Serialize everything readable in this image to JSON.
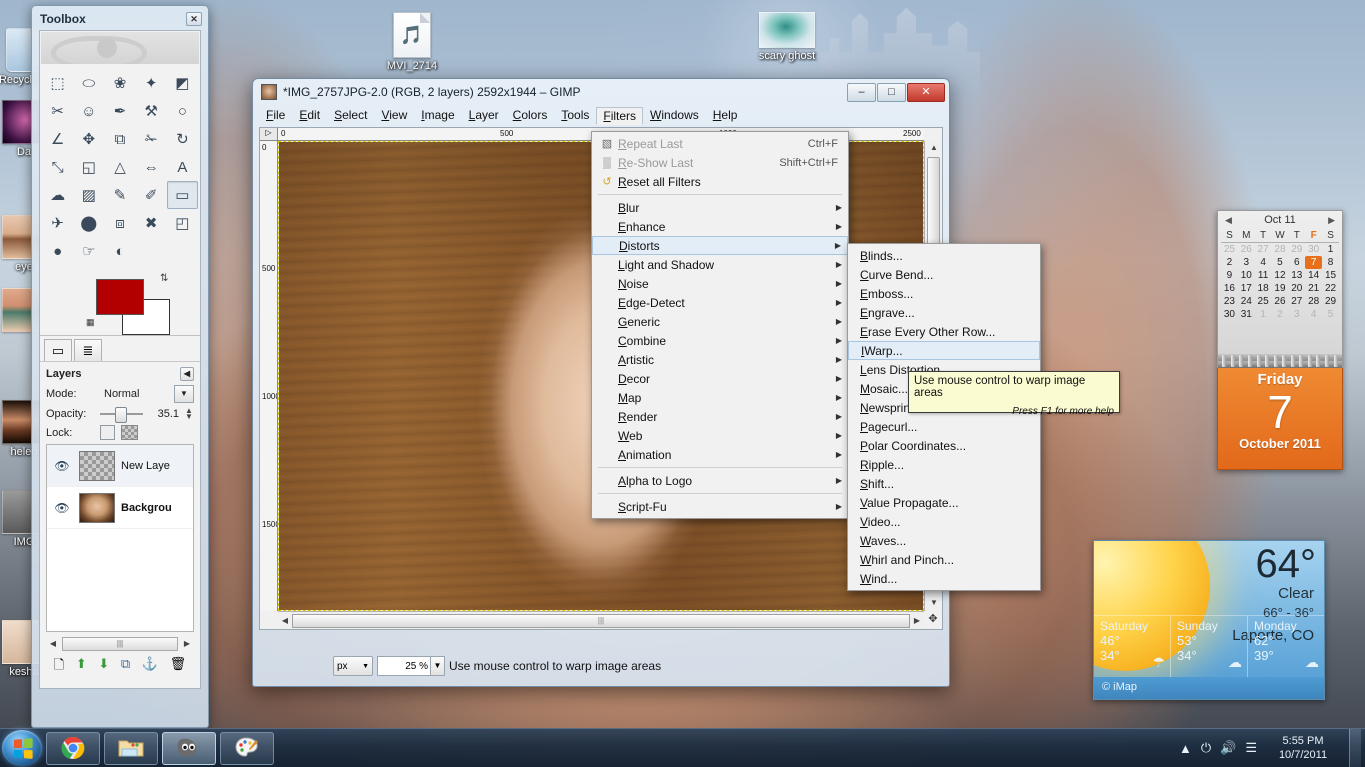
{
  "desktop": {
    "icons": [
      {
        "name": "Recycle Bin",
        "label": "Recycle Bin",
        "type": "recycle-bin"
      },
      {
        "name": "Dark",
        "label": "Da",
        "type": "image"
      },
      {
        "name": "eye",
        "label": "eye",
        "type": "image"
      },
      {
        "name": "eye2",
        "label": "",
        "type": "image"
      },
      {
        "name": "helen",
        "label": "helen",
        "type": "image"
      },
      {
        "name": "IMG",
        "label": "IMG",
        "type": "image"
      },
      {
        "name": "kesha",
        "label": "kesha",
        "type": "image"
      },
      {
        "name": "MVI_2714",
        "label": "MVI_2714",
        "type": "video-file"
      },
      {
        "name": "scary ghost",
        "label": "scary ghost",
        "type": "image"
      }
    ]
  },
  "calendar": {
    "header": "Oct 11",
    "prev_arrow": "◀",
    "next_arrow": "▶",
    "weekday_headers": [
      "S",
      "M",
      "T",
      "W",
      "T",
      "F",
      "S"
    ],
    "weeks": [
      [
        {
          "d": "25",
          "s": "dim"
        },
        {
          "d": "26",
          "s": "dim"
        },
        {
          "d": "27",
          "s": "dim"
        },
        {
          "d": "28",
          "s": "dim"
        },
        {
          "d": "29",
          "s": "dim"
        },
        {
          "d": "30",
          "s": "dim"
        },
        {
          "d": "1",
          "s": ""
        }
      ],
      [
        {
          "d": "2",
          "s": ""
        },
        {
          "d": "3",
          "s": ""
        },
        {
          "d": "4",
          "s": ""
        },
        {
          "d": "5",
          "s": ""
        },
        {
          "d": "6",
          "s": ""
        },
        {
          "d": "7",
          "s": "today"
        },
        {
          "d": "8",
          "s": ""
        }
      ],
      [
        {
          "d": "9",
          "s": ""
        },
        {
          "d": "10",
          "s": ""
        },
        {
          "d": "11",
          "s": ""
        },
        {
          "d": "12",
          "s": ""
        },
        {
          "d": "13",
          "s": ""
        },
        {
          "d": "14",
          "s": ""
        },
        {
          "d": "15",
          "s": ""
        }
      ],
      [
        {
          "d": "16",
          "s": ""
        },
        {
          "d": "17",
          "s": ""
        },
        {
          "d": "18",
          "s": ""
        },
        {
          "d": "19",
          "s": ""
        },
        {
          "d": "20",
          "s": ""
        },
        {
          "d": "21",
          "s": ""
        },
        {
          "d": "22",
          "s": ""
        }
      ],
      [
        {
          "d": "23",
          "s": ""
        },
        {
          "d": "24",
          "s": ""
        },
        {
          "d": "25",
          "s": ""
        },
        {
          "d": "26",
          "s": ""
        },
        {
          "d": "27",
          "s": ""
        },
        {
          "d": "28",
          "s": ""
        },
        {
          "d": "29",
          "s": ""
        }
      ],
      [
        {
          "d": "30",
          "s": ""
        },
        {
          "d": "31",
          "s": ""
        },
        {
          "d": "1",
          "s": "dim"
        },
        {
          "d": "2",
          "s": "dim"
        },
        {
          "d": "3",
          "s": "dim"
        },
        {
          "d": "4",
          "s": "dim"
        },
        {
          "d": "5",
          "s": "dim"
        }
      ]
    ],
    "day_name": "Friday",
    "day_number": "7",
    "month_year": "October 2011"
  },
  "weather": {
    "temperature": "64°",
    "condition": "Clear",
    "high_low": "66° - 36°",
    "location": "Laporte, CO",
    "forecast": [
      {
        "day": "Saturday",
        "high": "46°",
        "low": "34°",
        "icon": "rain"
      },
      {
        "day": "Sunday",
        "high": "53°",
        "low": "34°",
        "icon": "cloudy"
      },
      {
        "day": "Monday",
        "high": "62°",
        "low": "39°",
        "icon": "cloudy"
      }
    ],
    "attribution": "© iMap"
  },
  "toolbox": {
    "title": "Toolbox",
    "close_label": "✕",
    "tools": [
      {
        "n": "rect-select-tool",
        "g": "⬚"
      },
      {
        "n": "ellipse-select-tool",
        "g": "⬭"
      },
      {
        "n": "free-select-tool",
        "g": "❀"
      },
      {
        "n": "fuzzy-select-tool",
        "g": "✦"
      },
      {
        "n": "select-by-color-tool",
        "g": "◩"
      },
      {
        "n": "scissors-select-tool",
        "g": "✂"
      },
      {
        "n": "foreground-select-tool",
        "g": "☺"
      },
      {
        "n": "paths-tool",
        "g": "✒"
      },
      {
        "n": "color-picker-tool",
        "g": "⚒"
      },
      {
        "n": "zoom-tool",
        "g": "○"
      },
      {
        "n": "measure-tool",
        "g": "∠"
      },
      {
        "n": "move-tool",
        "g": "✥"
      },
      {
        "n": "alignment-tool",
        "g": "⧉"
      },
      {
        "n": "crop-tool",
        "g": "✁"
      },
      {
        "n": "rotate-tool",
        "g": "↻"
      },
      {
        "n": "scale-tool",
        "g": "⤡"
      },
      {
        "n": "shear-tool",
        "g": "◱"
      },
      {
        "n": "perspective-tool",
        "g": "△"
      },
      {
        "n": "flip-tool",
        "g": "⇔"
      },
      {
        "n": "text-tool",
        "g": "A"
      },
      {
        "n": "bucket-fill-tool",
        "g": "☁"
      },
      {
        "n": "gradient-tool",
        "g": "▨"
      },
      {
        "n": "pencil-tool",
        "g": "✎"
      },
      {
        "n": "paintbrush-tool",
        "g": "✐"
      },
      {
        "n": "eraser-tool",
        "g": "▭",
        "sel": true
      },
      {
        "n": "airbrush-tool",
        "g": "✈"
      },
      {
        "n": "ink-tool",
        "g": "⬤"
      },
      {
        "n": "clone-tool",
        "g": "⧈"
      },
      {
        "n": "heal-tool",
        "g": "✖"
      },
      {
        "n": "perspective-clone-tool",
        "g": "◰"
      },
      {
        "n": "blur-sharpen-tool",
        "g": "●"
      },
      {
        "n": "smudge-tool",
        "g": "☞"
      },
      {
        "n": "dodge-burn-tool",
        "g": "◐"
      }
    ],
    "foreground_color": "#b20000",
    "background_color": "#ffffff",
    "tabs": [
      {
        "n": "tool-options-tab",
        "g": "▭"
      },
      {
        "n": "device-status-tab",
        "g": "≣"
      }
    ]
  },
  "layers": {
    "panel_title": "Layers",
    "menu_icon": "◀",
    "mode_label": "Mode:",
    "mode_value": "Normal",
    "opacity_label": "Opacity:",
    "opacity_value": "35.1",
    "lock_label": "Lock:",
    "items": [
      {
        "name": "New Laye",
        "visible": true,
        "thumb": "transparent",
        "selected": true
      },
      {
        "name": "Backgrou",
        "visible": true,
        "thumb": "face",
        "selected": false
      }
    ],
    "buttons": [
      {
        "n": "new-layer-button",
        "g": "🗋"
      },
      {
        "n": "raise-layer-button",
        "g": "⬆"
      },
      {
        "n": "lower-layer-button",
        "g": "⬇"
      },
      {
        "n": "duplicate-layer-button",
        "g": "⧉"
      },
      {
        "n": "anchor-layer-button",
        "g": "⚓"
      },
      {
        "n": "delete-layer-button",
        "g": "🗑"
      }
    ]
  },
  "gimp_window": {
    "title": "*IMG_2757JPG-2.0 (RGB, 2 layers) 2592x1944 – GIMP",
    "minimize": "–",
    "maximize": "□",
    "close": "✕",
    "menubar": [
      "File",
      "Edit",
      "Select",
      "View",
      "Image",
      "Layer",
      "Colors",
      "Tools",
      "Filters",
      "Windows",
      "Help"
    ],
    "open_menu": "Filters",
    "ruler_h_ticks": [
      "0",
      "500",
      "1000",
      "2500"
    ],
    "ruler_v_ticks": [
      "0",
      "500",
      "1000",
      "1500"
    ],
    "unit": "px",
    "zoom": "25 %",
    "status_text": "Use mouse control to warp image areas"
  },
  "filters_menu": {
    "items": [
      {
        "label": "Repeat Last",
        "accel": "Ctrl+F",
        "disabled": true,
        "icon": "repeat-icon",
        "submenu": false
      },
      {
        "label": "Re-Show Last",
        "accel": "Shift+Ctrl+F",
        "disabled": true,
        "icon": "reshow-icon",
        "submenu": false
      },
      {
        "label": "Reset all Filters",
        "accel": "",
        "disabled": false,
        "icon": "reset-icon",
        "submenu": false
      },
      {
        "sep": true
      },
      {
        "label": "Blur",
        "accel": "",
        "disabled": false,
        "icon": "",
        "submenu": true
      },
      {
        "label": "Enhance",
        "accel": "",
        "disabled": false,
        "icon": "",
        "submenu": true
      },
      {
        "label": "Distorts",
        "accel": "",
        "disabled": false,
        "icon": "",
        "submenu": true,
        "highlighted": true
      },
      {
        "label": "Light and Shadow",
        "accel": "",
        "disabled": false,
        "icon": "",
        "submenu": true
      },
      {
        "label": "Noise",
        "accel": "",
        "disabled": false,
        "icon": "",
        "submenu": true
      },
      {
        "label": "Edge-Detect",
        "accel": "",
        "disabled": false,
        "icon": "",
        "submenu": true
      },
      {
        "label": "Generic",
        "accel": "",
        "disabled": false,
        "icon": "",
        "submenu": true
      },
      {
        "label": "Combine",
        "accel": "",
        "disabled": false,
        "icon": "",
        "submenu": true
      },
      {
        "label": "Artistic",
        "accel": "",
        "disabled": false,
        "icon": "",
        "submenu": true
      },
      {
        "label": "Decor",
        "accel": "",
        "disabled": false,
        "icon": "",
        "submenu": true
      },
      {
        "label": "Map",
        "accel": "",
        "disabled": false,
        "icon": "",
        "submenu": true
      },
      {
        "label": "Render",
        "accel": "",
        "disabled": false,
        "icon": "",
        "submenu": true
      },
      {
        "label": "Web",
        "accel": "",
        "disabled": false,
        "icon": "",
        "submenu": true
      },
      {
        "label": "Animation",
        "accel": "",
        "disabled": false,
        "icon": "",
        "submenu": true
      },
      {
        "sep": true
      },
      {
        "label": "Alpha to Logo",
        "accel": "",
        "disabled": false,
        "icon": "",
        "submenu": true
      },
      {
        "sep": true
      },
      {
        "label": "Script-Fu",
        "accel": "",
        "disabled": false,
        "icon": "",
        "submenu": true
      }
    ]
  },
  "distorts_menu": {
    "items": [
      {
        "label": "Blinds..."
      },
      {
        "label": "Curve Bend..."
      },
      {
        "label": "Emboss..."
      },
      {
        "label": "Engrave..."
      },
      {
        "label": "Erase Every Other Row..."
      },
      {
        "label": "IWarp...",
        "highlighted": true
      },
      {
        "label": "Lens Distortion..."
      },
      {
        "label": "Mosaic..."
      },
      {
        "label": "Newsprint..."
      },
      {
        "label": "Pagecurl..."
      },
      {
        "label": "Polar Coordinates..."
      },
      {
        "label": "Ripple..."
      },
      {
        "label": "Shift..."
      },
      {
        "label": "Value Propagate..."
      },
      {
        "label": "Video..."
      },
      {
        "label": "Waves..."
      },
      {
        "label": "Whirl and Pinch..."
      },
      {
        "label": "Wind..."
      }
    ]
  },
  "tooltip": {
    "text": "Use mouse control to warp image areas",
    "help": "Press F1 for more help"
  },
  "taskbar": {
    "start_label": "Start",
    "buttons": [
      {
        "name": "chrome-taskbar-button",
        "label": "Google Chrome",
        "active": false
      },
      {
        "name": "explorer-taskbar-button",
        "label": "Windows Explorer",
        "active": false
      },
      {
        "name": "gimp-taskbar-button",
        "label": "GIMP",
        "active": true
      },
      {
        "name": "paint-taskbar-button",
        "label": "Paint",
        "active": false
      }
    ],
    "tray": {
      "show_hidden": "▲",
      "battery_icon": "battery-icon",
      "volume_icon": "volume-icon",
      "network_icon": "network-icon",
      "time": "5:55 PM",
      "date": "10/7/2011"
    }
  }
}
